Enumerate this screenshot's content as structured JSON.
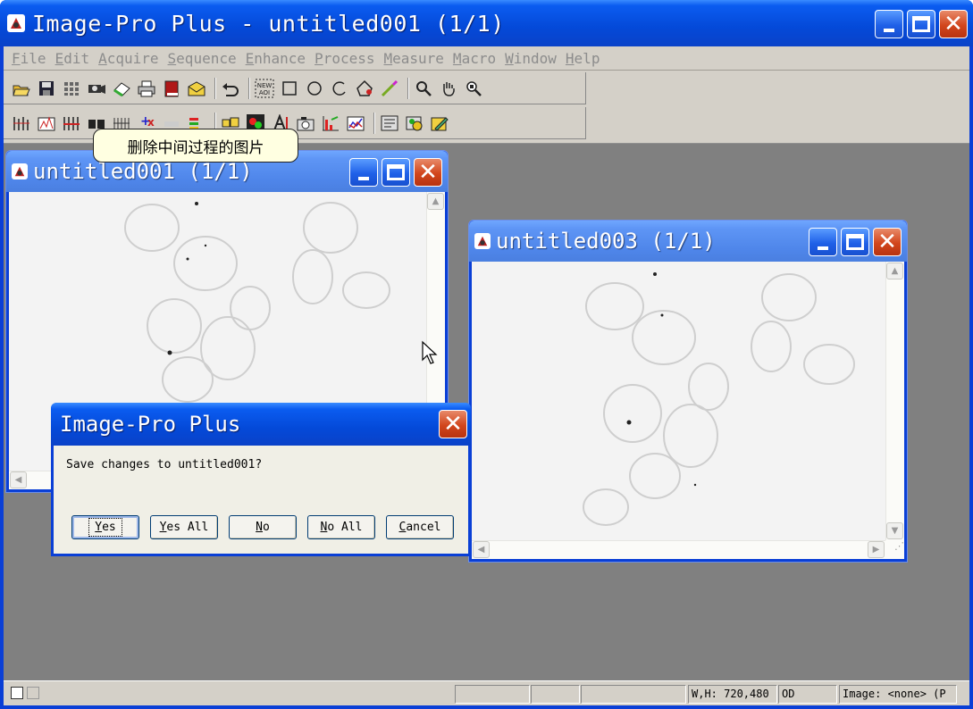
{
  "app": {
    "title": "Image-Pro Plus - untitled001 (1/1)"
  },
  "menu": [
    "File",
    "Edit",
    "Acquire",
    "Sequence",
    "Enhance",
    "Process",
    "Measure",
    "Macro",
    "Window",
    "Help"
  ],
  "toolbar1": {
    "icons": [
      "open-icon",
      "save-icon",
      "grid-icon",
      "camera-icon",
      "eraser-icon",
      "print-icon",
      "book-icon",
      "mail-icon",
      "undo-icon",
      "new-aoi-icon",
      "rectangle-aoi-icon",
      "ellipse-aoi-icon",
      "freeform-aoi-icon",
      "polygon-aoi-icon",
      "wand-icon",
      "zoom-icon",
      "pan-icon",
      "zoom-fit-icon"
    ],
    "new_aoi_label": "NEW\nAOI"
  },
  "toolbar2": {
    "icons": [
      "histogram-icon",
      "line-profile-icon",
      "bitmap-analysis-icon",
      "eraser-icon",
      "seq-icon",
      "grid-lines-icon",
      "add-remove-icon",
      "color-icon",
      "colors-icon",
      "merge-icon",
      "colocalization-icon",
      "calibration-icon",
      "camera-capture-icon",
      "histogram-chart-icon",
      "plot-icon",
      "macro-icon",
      "automation-icon",
      "edit-icon"
    ]
  },
  "tooltip": "删除中间过程的图片",
  "windows": {
    "win1": {
      "title": "untitled001 (1/1)"
    },
    "win3": {
      "title": "untitled003 (1/1)"
    }
  },
  "dialog": {
    "title": "Image-Pro Plus",
    "message": "Save changes to untitled001?",
    "buttons": [
      "Yes",
      "Yes All",
      "No",
      "No All",
      "Cancel"
    ]
  },
  "status": {
    "dims": "W,H: 720,480",
    "mode": "OD",
    "image": "Image: <none> (P"
  },
  "colors": {
    "xp_blue": "#0a3fd6",
    "inactive_title": "#5e95f5",
    "workspace": "#808080",
    "tooltip_bg": "#ffffe1",
    "close_red": "#d2461c"
  }
}
